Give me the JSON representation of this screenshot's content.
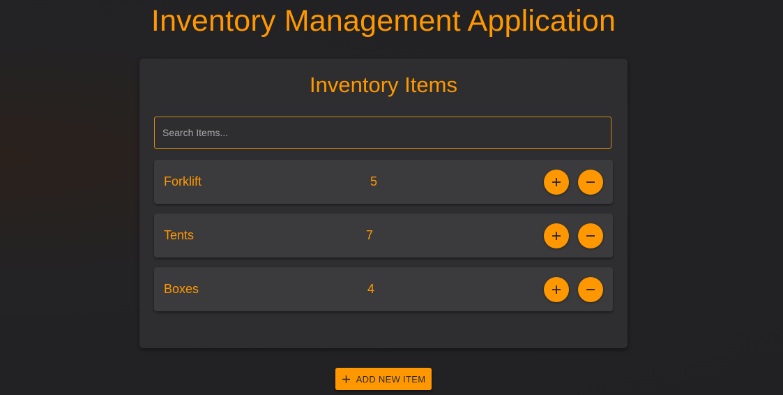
{
  "app": {
    "title": "Inventory Management Application"
  },
  "inventory": {
    "title": "Inventory Items",
    "search_placeholder": "Search Items...",
    "search_value": "",
    "items": [
      {
        "name": "Forklift",
        "quantity": "5",
        "increment_icon": "plus-icon",
        "decrement_icon": "minus-icon"
      },
      {
        "name": "Tents",
        "quantity": "7",
        "increment_icon": "plus-icon",
        "decrement_icon": "minus-icon"
      },
      {
        "name": "Boxes",
        "quantity": "4",
        "increment_icon": "plus-icon",
        "decrement_icon": "minus-icon"
      }
    ]
  },
  "actions": {
    "add_label": "ADD NEW ITEM",
    "add_icon": "plus-icon"
  },
  "colors": {
    "accent": "#ff9800",
    "panel": "#2e2e30",
    "row": "#3b3b3d",
    "background": "#212124"
  }
}
